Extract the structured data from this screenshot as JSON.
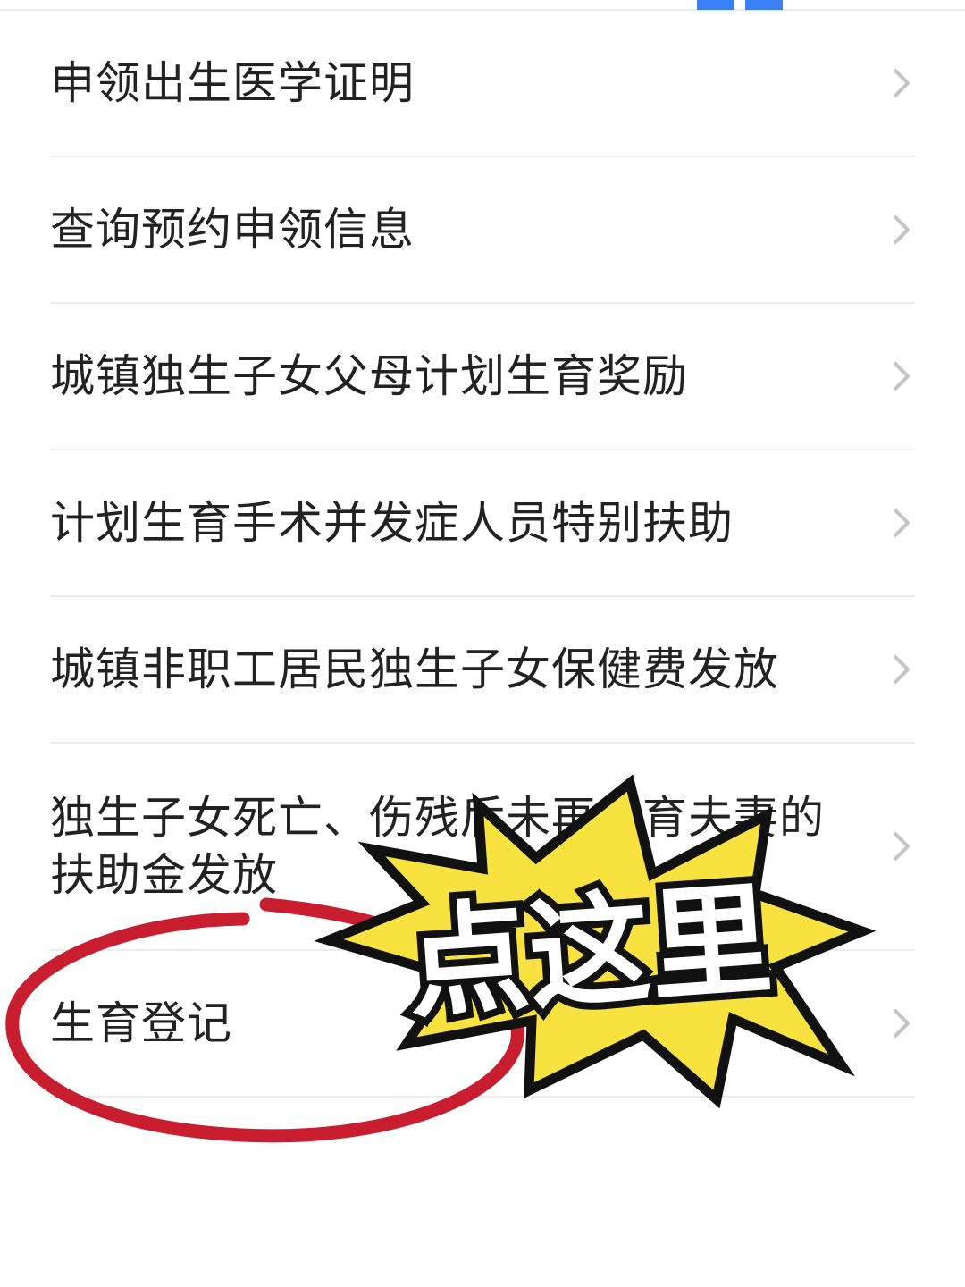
{
  "menu": {
    "items": [
      {
        "label": "申领出生医学证明"
      },
      {
        "label": "查询预约申领信息"
      },
      {
        "label": "城镇独生子女父母计划生育奖励"
      },
      {
        "label": "计划生育手术并发症人员特别扶助"
      },
      {
        "label": "城镇非职工居民独生子女保健费发放"
      },
      {
        "label": "独生子女死亡、伤残后未再生育夫妻的扶助金发放"
      },
      {
        "label": "生育登记"
      }
    ]
  },
  "annotation": {
    "callout_text": "点这里",
    "burst_color": "#f7e23f",
    "circle_color": "#c81e30"
  },
  "colors": {
    "accent": "#3b7ff5",
    "text": "#222222",
    "divider": "#ececec",
    "chevron": "#c4c4c4"
  }
}
